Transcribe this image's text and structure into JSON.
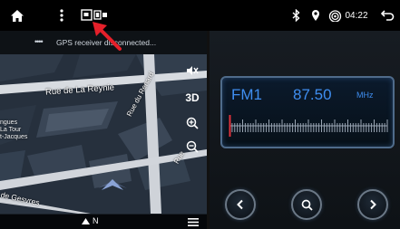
{
  "status": {
    "time": "04:22",
    "gps_message": "GPS receiver disconnected...",
    "signal_dots": "••••"
  },
  "map": {
    "street_1": "Rue de La Reynie",
    "street_2": "Rue du Renard",
    "street_3": "Rue",
    "street_4": "de Gesvres",
    "poi_label_line1": "ngues",
    "poi_label_line2": "La Tour",
    "poi_label_line3": "t-Jacques",
    "view_3d_label": "3D",
    "compass_label": "N"
  },
  "radio": {
    "band": "FM1",
    "frequency": "87.50",
    "unit": "MHz",
    "tuner_position": 0.02
  },
  "colors": {
    "accent_blue": "#3f8ef0",
    "tuner_marker": "#e0323c",
    "cursor_arrow": "#e5202a"
  },
  "icons": {
    "home": "home-icon",
    "menu": "vertical-dots-icon",
    "window_mode": "window-mode-icon",
    "bluetooth": "bluetooth-icon",
    "location": "location-pin-icon",
    "wifi": "wifi-icon",
    "back": "back-arrow-icon",
    "list": "list-menu-icon",
    "prev": "chevron-left-icon",
    "search": "search-icon",
    "next": "chevron-right-icon"
  }
}
